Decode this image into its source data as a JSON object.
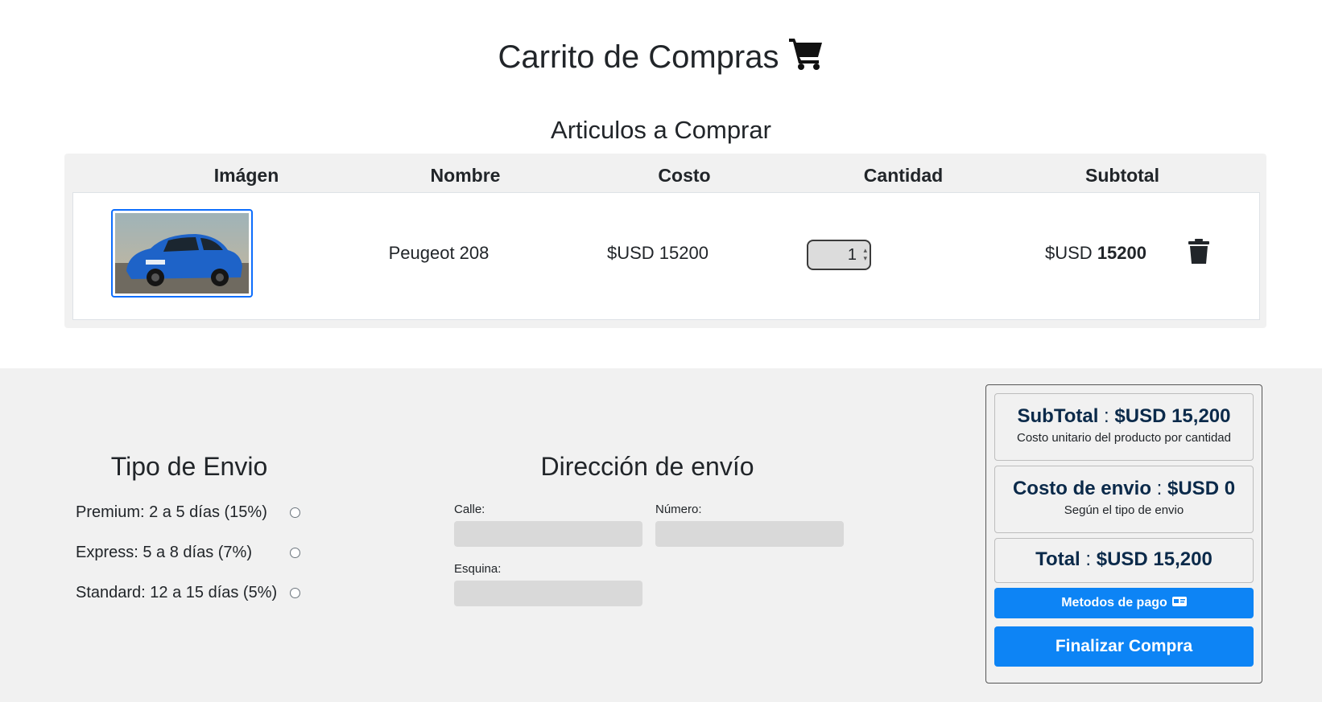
{
  "header": {
    "title": "Carrito de Compras",
    "cart_icon": "shopping-cart-icon"
  },
  "cart": {
    "title": "Articulos a Comprar",
    "columns": [
      "Imágen",
      "Nombre",
      "Costo",
      "Cantidad",
      "Subtotal"
    ],
    "items": [
      {
        "image_icon": "car-thumbnail",
        "name": "Peugeot 208",
        "cost": "$USD 15200",
        "quantity": "1",
        "subtotal_prefix": "$USD",
        "subtotal_value": "15200",
        "delete_icon": "trash-icon"
      }
    ]
  },
  "shipping": {
    "title": "Tipo de Envio",
    "options": [
      {
        "label": "Premium: 2 a 5 días (15%)",
        "selected": false
      },
      {
        "label": "Express: 5 a 8 días (7%)",
        "selected": false
      },
      {
        "label": "Standard: 12 a 15 días (5%)",
        "selected": false
      }
    ]
  },
  "address": {
    "title": "Dirección de envío",
    "street_label": "Calle:",
    "street_value": "",
    "number_label": "Número:",
    "number_value": "",
    "corner_label": "Esquina:",
    "corner_value": ""
  },
  "summary": {
    "subtotal_label": "SubTotal",
    "subtotal_value": "$USD 15,200",
    "subtotal_note": "Costo unitario del producto por cantidad",
    "shipping_label": "Costo de envio",
    "shipping_value": "$USD 0",
    "shipping_note": "Según el tipo de envio",
    "total_label": "Total",
    "total_value": "$USD 15,200",
    "separator": ":",
    "payment_button": "Metodos de pago",
    "payment_icon": "credit-card-icon",
    "finish_button": "Finalizar Compra"
  },
  "colors": {
    "primary": "#0d84f5",
    "background_gray": "#f1f1f1",
    "input_gray": "#d9d9d9",
    "summary_text": "#0b2a4a"
  }
}
